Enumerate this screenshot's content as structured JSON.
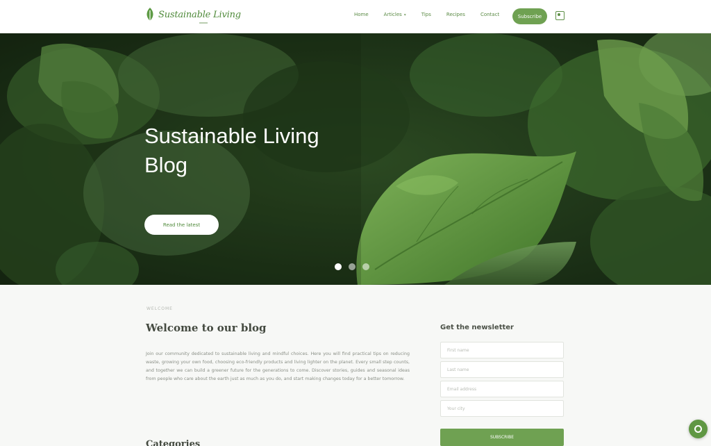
{
  "header": {
    "logo_text": "Sustainable Living",
    "nav": [
      {
        "label": "Home"
      },
      {
        "label": "Articles",
        "has_caret": true
      },
      {
        "label": "Tips"
      },
      {
        "label": "Recipes"
      },
      {
        "label": "Contact"
      }
    ],
    "cta_label": "Subscribe",
    "icon": "account-icon"
  },
  "hero": {
    "title": "Sustainable Living Blog",
    "button_label": "Read the latest",
    "carousel": {
      "total": 3,
      "active": 1
    }
  },
  "main": {
    "eyebrow": "WELCOME",
    "title": "Welcome to our blog",
    "paragraph": "Join our community dedicated to sustainable living and mindful choices. Here you will find practical tips on reducing waste, growing your own food, choosing eco-friendly products and living lighter on the planet. Every small step counts, and together we can build a greener future for the generations to come. Discover stories, guides and seasonal ideas from people who care about the earth just as much as you do, and start making changes today for a better tomorrow.",
    "subheading": "Categories"
  },
  "sidebar": {
    "form_title": "Get the newsletter",
    "fields": [
      {
        "placeholder": "First name"
      },
      {
        "placeholder": "Last name"
      },
      {
        "placeholder": "Email address"
      },
      {
        "placeholder": "Your city"
      }
    ],
    "submit_label": "SUBSCRIBE"
  },
  "colors": {
    "accent": "#6fa152",
    "brand_text": "#4f8a3a",
    "hero_dark": "#1f3318"
  },
  "chat": {
    "icon": "chat-icon"
  }
}
